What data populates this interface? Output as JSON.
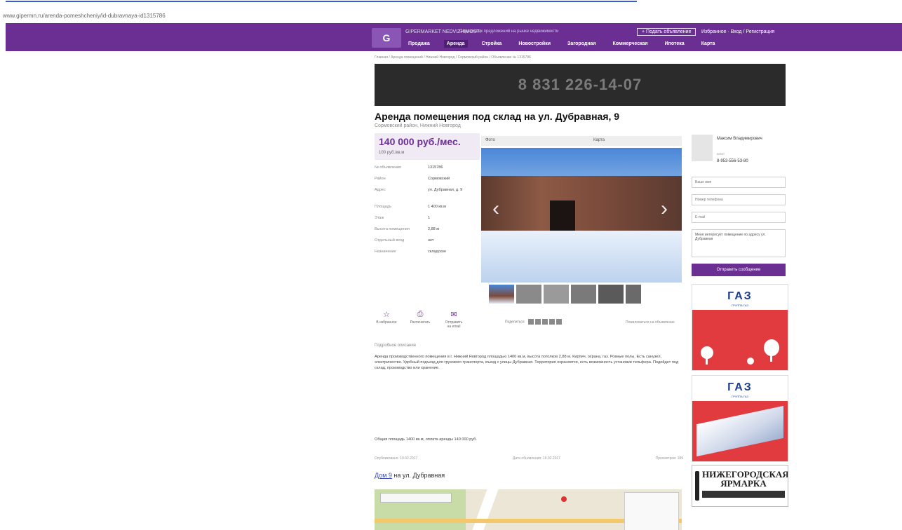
{
  "browser": {
    "url": "www.gipermn.ru/arenda-pomeshcheniy/id-dubravnaya-id1315786"
  },
  "header": {
    "site_name": "GIPERMARKET NEDVIZHIMOSTI",
    "tagline": "Справочник предложений на рынке недвижимости",
    "add_button": "+ Подать объявление",
    "top_links": "Избранное · Вход / Регистрация",
    "nav": [
      "Продажа",
      "Аренда",
      "Стройка",
      "Новостройки",
      "Загородная",
      "Коммерческая",
      "Ипотека",
      "Карта"
    ]
  },
  "breadcrumbs": "Главная / Аренда помещений / Нижний Новгород / Сормовский район / Объявление № 1315786",
  "banner": {
    "phone": "8 831 226-14-07"
  },
  "listing": {
    "title": "Аренда помещения под склад на ул. Дубравная, 9",
    "subtitle": "Сормовский район, Нижний Новгород",
    "price": "140 000 руб./мес.",
    "price_sub": "100 руб./кв.м",
    "specs": [
      {
        "k": "№ объявления",
        "v": "1315786"
      },
      {
        "k": "Район",
        "v": "Сормовский"
      },
      {
        "k": "Адрес",
        "v": "ул. Дубравная, д. 9"
      },
      {
        "k": "Площадь",
        "v": "1 400 кв.м"
      },
      {
        "k": "Этаж",
        "v": "1"
      },
      {
        "k": "Высота помещения",
        "v": "2,88 м"
      },
      {
        "k": "Отдельный вход",
        "v": "нет"
      },
      {
        "k": "Назначение",
        "v": "складское"
      }
    ]
  },
  "photo_tabs": [
    "Фото",
    "Карта"
  ],
  "actions": [
    {
      "icon": "☆",
      "label": "В избранное"
    },
    {
      "icon": "⎙",
      "label": "Распечатать"
    },
    {
      "icon": "✉",
      "label": "Отправить на email"
    }
  ],
  "share_label": "Поделиться",
  "complaint": "Пожаловаться на объявление",
  "description": {
    "heading": "Подробное описание",
    "text": "Аренда производственного помещения в г. Нижний Новгород площадью 1400 кв.м, высота потолков 2,88 м. Кирпич, охрана, газ. Ровные полы. Есть санузел, электричество. Удобный подъезд для грузового транспорта, въезд с улицы Дубравная. Территория охраняется, есть возможность установки тельфера. Подойдет под склад, производство или хранение.",
    "total": "Общая площадь 1400 кв.м, оплата аренды 140 000 руб."
  },
  "dates": {
    "published": "Опубликовано: 19.02.2017",
    "updated": "Дата обновления: 19.02.2017",
    "views": "Просмотров: 189"
  },
  "map_section": {
    "link": "Дом 9",
    "rest": "на ул. Дубравная"
  },
  "contact": {
    "name": "Максим Владимирович",
    "role": "агент",
    "phone": "8-953-556-53-80",
    "name_placeholder": "Ваше имя",
    "phone_placeholder": "Номер телефона",
    "email_placeholder": "E-mail",
    "message": "Меня интересует помещение по адресу ул. Дубравная",
    "send_label": "Отправить сообщение"
  },
  "ads": [
    {
      "logo": "ГАЗ",
      "sub": "ГРУППА ГАЗ"
    },
    {
      "logo": "ГАЗ",
      "sub": "ГРУППА ГАЗ"
    },
    {
      "title": "НИЖЕГОРОДСКАЯ ЯРМАРКА"
    }
  ]
}
